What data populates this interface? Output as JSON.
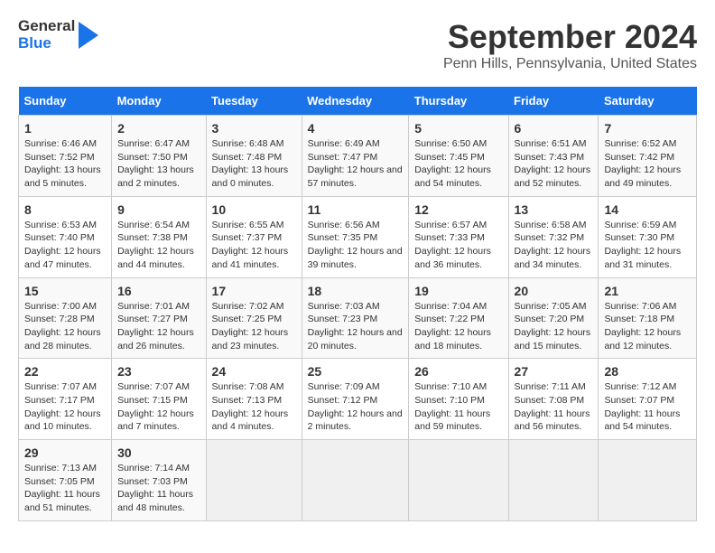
{
  "logo": {
    "text_general": "General",
    "text_blue": "Blue"
  },
  "header": {
    "title": "September 2024",
    "subtitle": "Penn Hills, Pennsylvania, United States"
  },
  "days_of_week": [
    "Sunday",
    "Monday",
    "Tuesday",
    "Wednesday",
    "Thursday",
    "Friday",
    "Saturday"
  ],
  "weeks": [
    [
      {
        "day": "1",
        "sunrise": "6:46 AM",
        "sunset": "7:52 PM",
        "daylight": "13 hours and 5 minutes."
      },
      {
        "day": "2",
        "sunrise": "6:47 AM",
        "sunset": "7:50 PM",
        "daylight": "13 hours and 2 minutes."
      },
      {
        "day": "3",
        "sunrise": "6:48 AM",
        "sunset": "7:48 PM",
        "daylight": "13 hours and 0 minutes."
      },
      {
        "day": "4",
        "sunrise": "6:49 AM",
        "sunset": "7:47 PM",
        "daylight": "12 hours and 57 minutes."
      },
      {
        "day": "5",
        "sunrise": "6:50 AM",
        "sunset": "7:45 PM",
        "daylight": "12 hours and 54 minutes."
      },
      {
        "day": "6",
        "sunrise": "6:51 AM",
        "sunset": "7:43 PM",
        "daylight": "12 hours and 52 minutes."
      },
      {
        "day": "7",
        "sunrise": "6:52 AM",
        "sunset": "7:42 PM",
        "daylight": "12 hours and 49 minutes."
      }
    ],
    [
      {
        "day": "8",
        "sunrise": "6:53 AM",
        "sunset": "7:40 PM",
        "daylight": "12 hours and 47 minutes."
      },
      {
        "day": "9",
        "sunrise": "6:54 AM",
        "sunset": "7:38 PM",
        "daylight": "12 hours and 44 minutes."
      },
      {
        "day": "10",
        "sunrise": "6:55 AM",
        "sunset": "7:37 PM",
        "daylight": "12 hours and 41 minutes."
      },
      {
        "day": "11",
        "sunrise": "6:56 AM",
        "sunset": "7:35 PM",
        "daylight": "12 hours and 39 minutes."
      },
      {
        "day": "12",
        "sunrise": "6:57 AM",
        "sunset": "7:33 PM",
        "daylight": "12 hours and 36 minutes."
      },
      {
        "day": "13",
        "sunrise": "6:58 AM",
        "sunset": "7:32 PM",
        "daylight": "12 hours and 34 minutes."
      },
      {
        "day": "14",
        "sunrise": "6:59 AM",
        "sunset": "7:30 PM",
        "daylight": "12 hours and 31 minutes."
      }
    ],
    [
      {
        "day": "15",
        "sunrise": "7:00 AM",
        "sunset": "7:28 PM",
        "daylight": "12 hours and 28 minutes."
      },
      {
        "day": "16",
        "sunrise": "7:01 AM",
        "sunset": "7:27 PM",
        "daylight": "12 hours and 26 minutes."
      },
      {
        "day": "17",
        "sunrise": "7:02 AM",
        "sunset": "7:25 PM",
        "daylight": "12 hours and 23 minutes."
      },
      {
        "day": "18",
        "sunrise": "7:03 AM",
        "sunset": "7:23 PM",
        "daylight": "12 hours and 20 minutes."
      },
      {
        "day": "19",
        "sunrise": "7:04 AM",
        "sunset": "7:22 PM",
        "daylight": "12 hours and 18 minutes."
      },
      {
        "day": "20",
        "sunrise": "7:05 AM",
        "sunset": "7:20 PM",
        "daylight": "12 hours and 15 minutes."
      },
      {
        "day": "21",
        "sunrise": "7:06 AM",
        "sunset": "7:18 PM",
        "daylight": "12 hours and 12 minutes."
      }
    ],
    [
      {
        "day": "22",
        "sunrise": "7:07 AM",
        "sunset": "7:17 PM",
        "daylight": "12 hours and 10 minutes."
      },
      {
        "day": "23",
        "sunrise": "7:07 AM",
        "sunset": "7:15 PM",
        "daylight": "12 hours and 7 minutes."
      },
      {
        "day": "24",
        "sunrise": "7:08 AM",
        "sunset": "7:13 PM",
        "daylight": "12 hours and 4 minutes."
      },
      {
        "day": "25",
        "sunrise": "7:09 AM",
        "sunset": "7:12 PM",
        "daylight": "12 hours and 2 minutes."
      },
      {
        "day": "26",
        "sunrise": "7:10 AM",
        "sunset": "7:10 PM",
        "daylight": "11 hours and 59 minutes."
      },
      {
        "day": "27",
        "sunrise": "7:11 AM",
        "sunset": "7:08 PM",
        "daylight": "11 hours and 56 minutes."
      },
      {
        "day": "28",
        "sunrise": "7:12 AM",
        "sunset": "7:07 PM",
        "daylight": "11 hours and 54 minutes."
      }
    ],
    [
      {
        "day": "29",
        "sunrise": "7:13 AM",
        "sunset": "7:05 PM",
        "daylight": "11 hours and 51 minutes."
      },
      {
        "day": "30",
        "sunrise": "7:14 AM",
        "sunset": "7:03 PM",
        "daylight": "11 hours and 48 minutes."
      },
      null,
      null,
      null,
      null,
      null
    ]
  ]
}
